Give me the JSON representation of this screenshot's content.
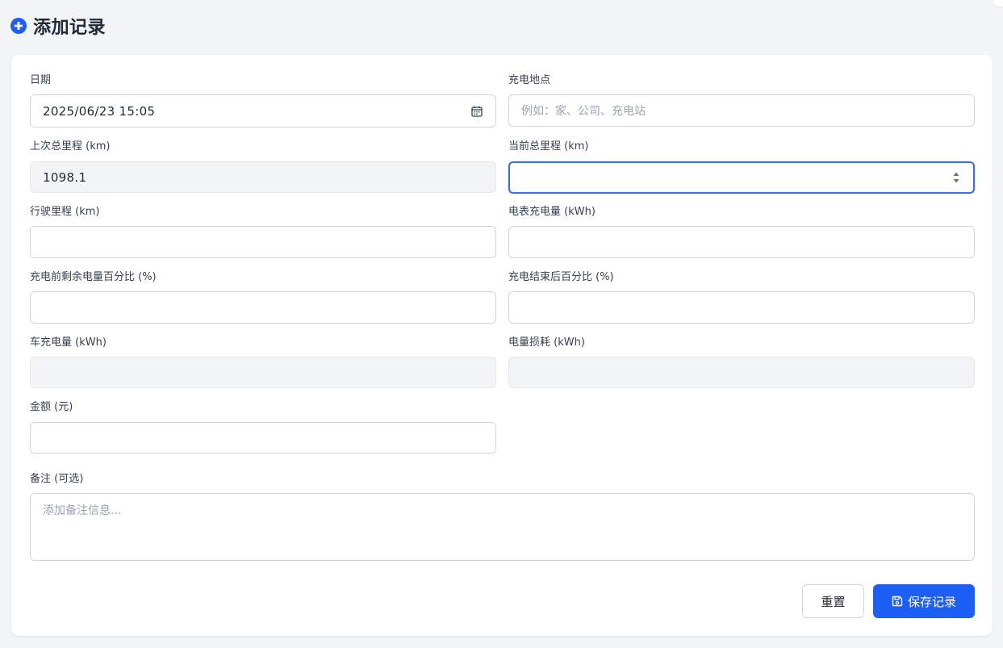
{
  "header": {
    "title": "添加记录",
    "icon": "plus-circle-icon",
    "accent": "#1d5ff5"
  },
  "form": {
    "date": {
      "label": "日期",
      "value": "2025/06/23  15:05",
      "icon": "calendar-icon"
    },
    "location": {
      "label": "充电地点",
      "placeholder": "例如：家、公司、充电站"
    },
    "last_odometer": {
      "label": "上次总里程 (km)",
      "value": "1098.1"
    },
    "current_odometer": {
      "label": "当前总里程 (km)",
      "value": "",
      "icon": "spinner-arrows-icon"
    },
    "trip_distance": {
      "label": "行驶里程 (km)",
      "value": ""
    },
    "meter_energy": {
      "label": "电表充电量 (kWh)",
      "value": ""
    },
    "soc_before": {
      "label": "充电前剩余电量百分比 (%)",
      "value": ""
    },
    "soc_after": {
      "label": "充电结束后百分比 (%)",
      "value": ""
    },
    "car_energy": {
      "label": "车充电量 (kWh)",
      "value": ""
    },
    "energy_loss": {
      "label": "电量损耗 (kWh)",
      "value": ""
    },
    "amount": {
      "label": "金额 (元)",
      "value": ""
    },
    "notes": {
      "label": "备注 (可选)",
      "placeholder": "添加备注信息..."
    }
  },
  "actions": {
    "reset_label": "重置",
    "save_label": "保存记录",
    "save_icon": "floppy-disk-icon"
  }
}
